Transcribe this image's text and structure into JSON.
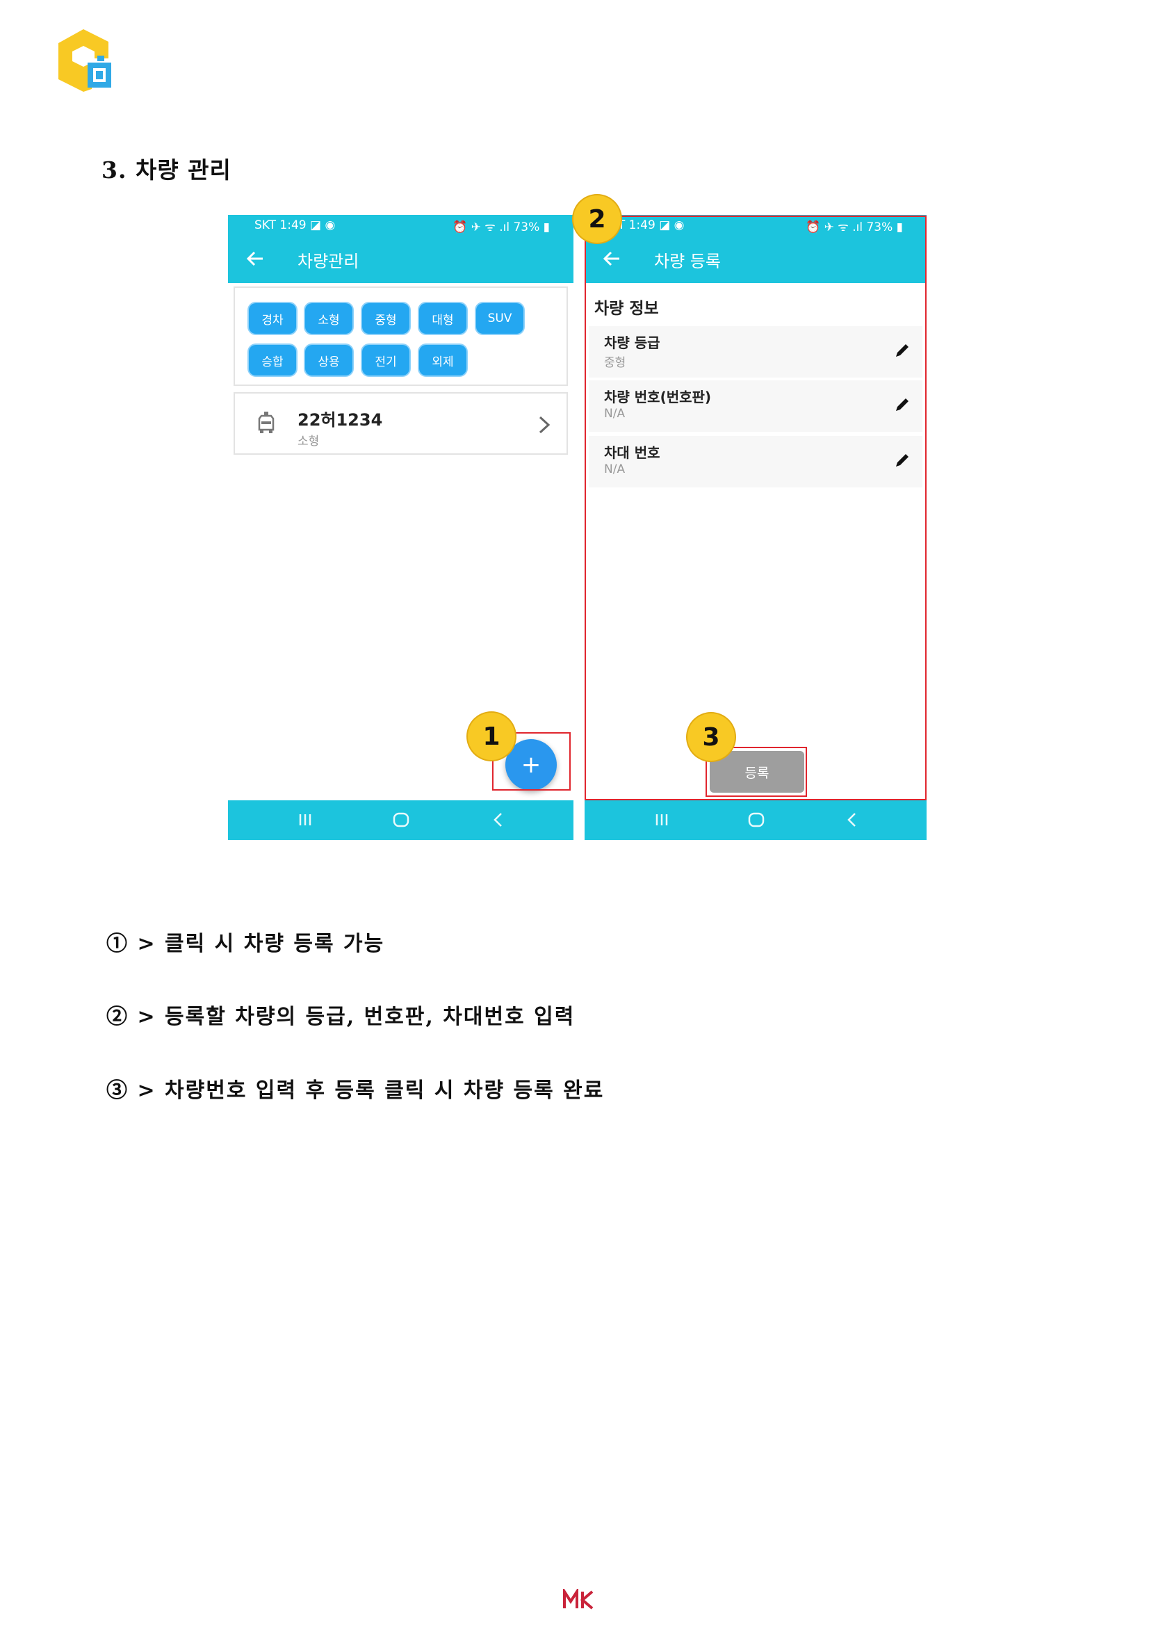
{
  "brand": {
    "logo_icon": "shield-app-logo-icon",
    "logo_color": "#f8c924",
    "logo_accent": "#30a9e6"
  },
  "section_title": "3. 차량 관리",
  "colors": {
    "app_bar": "#1cc4dd",
    "chip": "#24a7f1",
    "fab": "#2a97ee",
    "highlight": "#e0262e",
    "badge": "#f8c924"
  },
  "phone1": {
    "status_left": "SKT 1:49 ◪ ◉",
    "status_right": "⏰ ✈ ᯤ .ıl 73% ▮",
    "title": "차량관리",
    "chips": [
      "경차",
      "소형",
      "중형",
      "대형",
      "SUV",
      "승합",
      "상용",
      "전기",
      "외제"
    ],
    "vehicle": {
      "plate": "22허1234",
      "size": "소형"
    },
    "fab_label": "+",
    "badge": "1"
  },
  "phone2": {
    "status_left": "KT 1:49 ◪ ◉",
    "status_right": "⏰ ✈ ᯤ .ıl 73% ▮",
    "title": "차량 등록",
    "section_label": "차량 정보",
    "fields": [
      {
        "label": "차량 등급",
        "value": "중형"
      },
      {
        "label": "차량 번호(번호판)",
        "value": "N/A"
      },
      {
        "label": "차대 번호",
        "value": "N/A"
      }
    ],
    "submit_label": "등록",
    "badge_top": "2",
    "badge_bottom": "3"
  },
  "notes": [
    "① > 클릭 시 차량 등록 가능",
    "② > 등록할 차량의 등급, 번호판, 차대번호 입력",
    "③ > 차량번호 입력 후 등록 클릭 시 차량 등록 완료"
  ],
  "footer_logo_text": "MK"
}
